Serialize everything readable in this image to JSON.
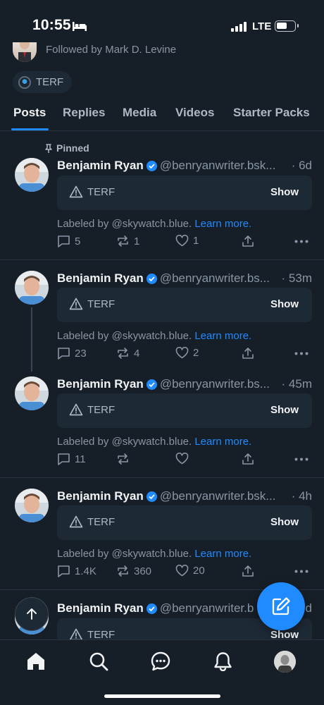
{
  "status_bar": {
    "time": "10:55",
    "network": "LTE"
  },
  "profile": {
    "followed_by": "Followed by Mark D. Levine",
    "label_chip": "TERF"
  },
  "tabs": [
    "Posts",
    "Replies",
    "Media",
    "Videos",
    "Starter Packs"
  ],
  "active_tab": "Posts",
  "pinned_label": "Pinned",
  "posts": [
    {
      "name": "Benjamin Ryan",
      "handle": "@benryanwriter.bsk...",
      "time": "· 6d",
      "content_label": "TERF",
      "show_label": "Show",
      "labeled_by": "Labeled by @skywatch.blue.",
      "learn_more": "Learn more.",
      "replies": "5",
      "reposts": "1",
      "likes": "1"
    },
    {
      "name": "Benjamin Ryan",
      "handle": "@benryanwriter.bs...",
      "time": "· 53m",
      "content_label": "TERF",
      "show_label": "Show",
      "labeled_by": "Labeled by @skywatch.blue.",
      "learn_more": "Learn more.",
      "replies": "23",
      "reposts": "4",
      "likes": "2"
    },
    {
      "name": "Benjamin Ryan",
      "handle": "@benryanwriter.bs...",
      "time": "· 45m",
      "content_label": "TERF",
      "show_label": "Show",
      "labeled_by": "Labeled by @skywatch.blue.",
      "learn_more": "Learn more.",
      "replies": "11",
      "reposts": "",
      "likes": ""
    },
    {
      "name": "Benjamin Ryan",
      "handle": "@benryanwriter.bsk...",
      "time": "· 4h",
      "content_label": "TERF",
      "show_label": "Show",
      "labeled_by": "Labeled by @skywatch.blue.",
      "learn_more": "Learn more.",
      "replies": "1.4K",
      "reposts": "360",
      "likes": "20"
    },
    {
      "name": "Benjamin Ryan",
      "handle": "@benryanwriter.b",
      "time": "d",
      "content_label": "TERF",
      "show_label": "Show"
    }
  ],
  "bottom_nav": [
    "home-icon",
    "search-icon",
    "chat-icon",
    "bell-icon",
    "profile-avatar"
  ],
  "colors": {
    "background": "#161e27",
    "accent": "#208bfe",
    "card": "#1e2936",
    "muted": "#8896a5"
  }
}
